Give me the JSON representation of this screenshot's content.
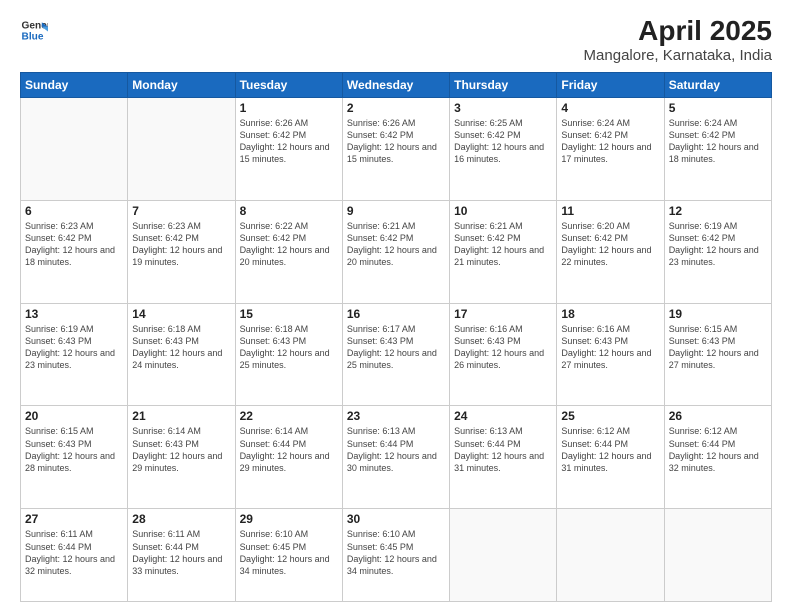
{
  "logo": {
    "line1": "General",
    "line2": "Blue"
  },
  "title": "April 2025",
  "subtitle": "Mangalore, Karnataka, India",
  "headers": [
    "Sunday",
    "Monday",
    "Tuesday",
    "Wednesday",
    "Thursday",
    "Friday",
    "Saturday"
  ],
  "weeks": [
    [
      {
        "day": "",
        "info": ""
      },
      {
        "day": "",
        "info": ""
      },
      {
        "day": "1",
        "info": "Sunrise: 6:26 AM\nSunset: 6:42 PM\nDaylight: 12 hours and 15 minutes."
      },
      {
        "day": "2",
        "info": "Sunrise: 6:26 AM\nSunset: 6:42 PM\nDaylight: 12 hours and 15 minutes."
      },
      {
        "day": "3",
        "info": "Sunrise: 6:25 AM\nSunset: 6:42 PM\nDaylight: 12 hours and 16 minutes."
      },
      {
        "day": "4",
        "info": "Sunrise: 6:24 AM\nSunset: 6:42 PM\nDaylight: 12 hours and 17 minutes."
      },
      {
        "day": "5",
        "info": "Sunrise: 6:24 AM\nSunset: 6:42 PM\nDaylight: 12 hours and 18 minutes."
      }
    ],
    [
      {
        "day": "6",
        "info": "Sunrise: 6:23 AM\nSunset: 6:42 PM\nDaylight: 12 hours and 18 minutes."
      },
      {
        "day": "7",
        "info": "Sunrise: 6:23 AM\nSunset: 6:42 PM\nDaylight: 12 hours and 19 minutes."
      },
      {
        "day": "8",
        "info": "Sunrise: 6:22 AM\nSunset: 6:42 PM\nDaylight: 12 hours and 20 minutes."
      },
      {
        "day": "9",
        "info": "Sunrise: 6:21 AM\nSunset: 6:42 PM\nDaylight: 12 hours and 20 minutes."
      },
      {
        "day": "10",
        "info": "Sunrise: 6:21 AM\nSunset: 6:42 PM\nDaylight: 12 hours and 21 minutes."
      },
      {
        "day": "11",
        "info": "Sunrise: 6:20 AM\nSunset: 6:42 PM\nDaylight: 12 hours and 22 minutes."
      },
      {
        "day": "12",
        "info": "Sunrise: 6:19 AM\nSunset: 6:42 PM\nDaylight: 12 hours and 23 minutes."
      }
    ],
    [
      {
        "day": "13",
        "info": "Sunrise: 6:19 AM\nSunset: 6:43 PM\nDaylight: 12 hours and 23 minutes."
      },
      {
        "day": "14",
        "info": "Sunrise: 6:18 AM\nSunset: 6:43 PM\nDaylight: 12 hours and 24 minutes."
      },
      {
        "day": "15",
        "info": "Sunrise: 6:18 AM\nSunset: 6:43 PM\nDaylight: 12 hours and 25 minutes."
      },
      {
        "day": "16",
        "info": "Sunrise: 6:17 AM\nSunset: 6:43 PM\nDaylight: 12 hours and 25 minutes."
      },
      {
        "day": "17",
        "info": "Sunrise: 6:16 AM\nSunset: 6:43 PM\nDaylight: 12 hours and 26 minutes."
      },
      {
        "day": "18",
        "info": "Sunrise: 6:16 AM\nSunset: 6:43 PM\nDaylight: 12 hours and 27 minutes."
      },
      {
        "day": "19",
        "info": "Sunrise: 6:15 AM\nSunset: 6:43 PM\nDaylight: 12 hours and 27 minutes."
      }
    ],
    [
      {
        "day": "20",
        "info": "Sunrise: 6:15 AM\nSunset: 6:43 PM\nDaylight: 12 hours and 28 minutes."
      },
      {
        "day": "21",
        "info": "Sunrise: 6:14 AM\nSunset: 6:43 PM\nDaylight: 12 hours and 29 minutes."
      },
      {
        "day": "22",
        "info": "Sunrise: 6:14 AM\nSunset: 6:44 PM\nDaylight: 12 hours and 29 minutes."
      },
      {
        "day": "23",
        "info": "Sunrise: 6:13 AM\nSunset: 6:44 PM\nDaylight: 12 hours and 30 minutes."
      },
      {
        "day": "24",
        "info": "Sunrise: 6:13 AM\nSunset: 6:44 PM\nDaylight: 12 hours and 31 minutes."
      },
      {
        "day": "25",
        "info": "Sunrise: 6:12 AM\nSunset: 6:44 PM\nDaylight: 12 hours and 31 minutes."
      },
      {
        "day": "26",
        "info": "Sunrise: 6:12 AM\nSunset: 6:44 PM\nDaylight: 12 hours and 32 minutes."
      }
    ],
    [
      {
        "day": "27",
        "info": "Sunrise: 6:11 AM\nSunset: 6:44 PM\nDaylight: 12 hours and 32 minutes."
      },
      {
        "day": "28",
        "info": "Sunrise: 6:11 AM\nSunset: 6:44 PM\nDaylight: 12 hours and 33 minutes."
      },
      {
        "day": "29",
        "info": "Sunrise: 6:10 AM\nSunset: 6:45 PM\nDaylight: 12 hours and 34 minutes."
      },
      {
        "day": "30",
        "info": "Sunrise: 6:10 AM\nSunset: 6:45 PM\nDaylight: 12 hours and 34 minutes."
      },
      {
        "day": "",
        "info": ""
      },
      {
        "day": "",
        "info": ""
      },
      {
        "day": "",
        "info": ""
      }
    ]
  ]
}
